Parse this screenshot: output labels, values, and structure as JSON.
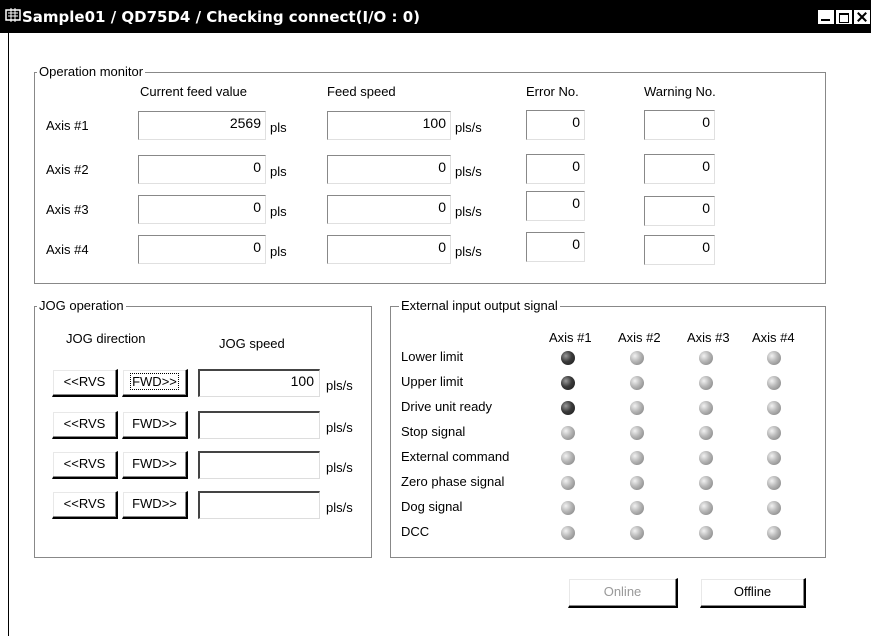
{
  "window": {
    "title": "Sample01 / QD75D4 / Checking connect(I/O : 0)"
  },
  "operation_monitor": {
    "legend": "Operation monitor",
    "headers": {
      "feed_value": "Current feed value",
      "feed_speed": "Feed speed",
      "error_no": "Error No.",
      "warning_no": "Warning No."
    },
    "axes": [
      {
        "label": "Axis #1",
        "feed_value": "2569",
        "feed_unit": "pls",
        "speed": "100",
        "speed_unit": "pls/s",
        "error": "0",
        "warning": "0"
      },
      {
        "label": "Axis #2",
        "feed_value": "0",
        "feed_unit": "pls",
        "speed": "0",
        "speed_unit": "pls/s",
        "error": "0",
        "warning": "0"
      },
      {
        "label": "Axis #3",
        "feed_value": "0",
        "feed_unit": "pls",
        "speed": "0",
        "speed_unit": "pls/s",
        "error": "0",
        "warning": "0"
      },
      {
        "label": "Axis #4",
        "feed_value": "0",
        "feed_unit": "pls",
        "speed": "0",
        "speed_unit": "pls/s",
        "error": "0",
        "warning": "0"
      }
    ]
  },
  "jog": {
    "legend": "JOG operation",
    "direction_header": "JOG direction",
    "speed_header": "JOG speed",
    "rvs_label": "<<RVS",
    "fwd_label": "FWD>>",
    "unit": "pls/s",
    "speeds": [
      "100",
      "",
      "",
      ""
    ]
  },
  "io": {
    "legend": "External input output signal",
    "axis_headers": [
      "Axis #1",
      "Axis #2",
      "Axis #3",
      "Axis #4"
    ],
    "signals": [
      {
        "label": "Lower limit",
        "states": [
          true,
          false,
          false,
          false
        ]
      },
      {
        "label": "Upper limit",
        "states": [
          true,
          false,
          false,
          false
        ]
      },
      {
        "label": "Drive unit ready",
        "states": [
          true,
          false,
          false,
          false
        ]
      },
      {
        "label": "Stop signal",
        "states": [
          false,
          false,
          false,
          false
        ]
      },
      {
        "label": "External command",
        "states": [
          false,
          false,
          false,
          false
        ]
      },
      {
        "label": "Zero phase signal",
        "states": [
          false,
          false,
          false,
          false
        ]
      },
      {
        "label": "Dog signal",
        "states": [
          false,
          false,
          false,
          false
        ]
      },
      {
        "label": "DCC",
        "states": [
          false,
          false,
          false,
          false
        ]
      }
    ]
  },
  "buttons": {
    "online": "Online",
    "offline": "Offline"
  }
}
